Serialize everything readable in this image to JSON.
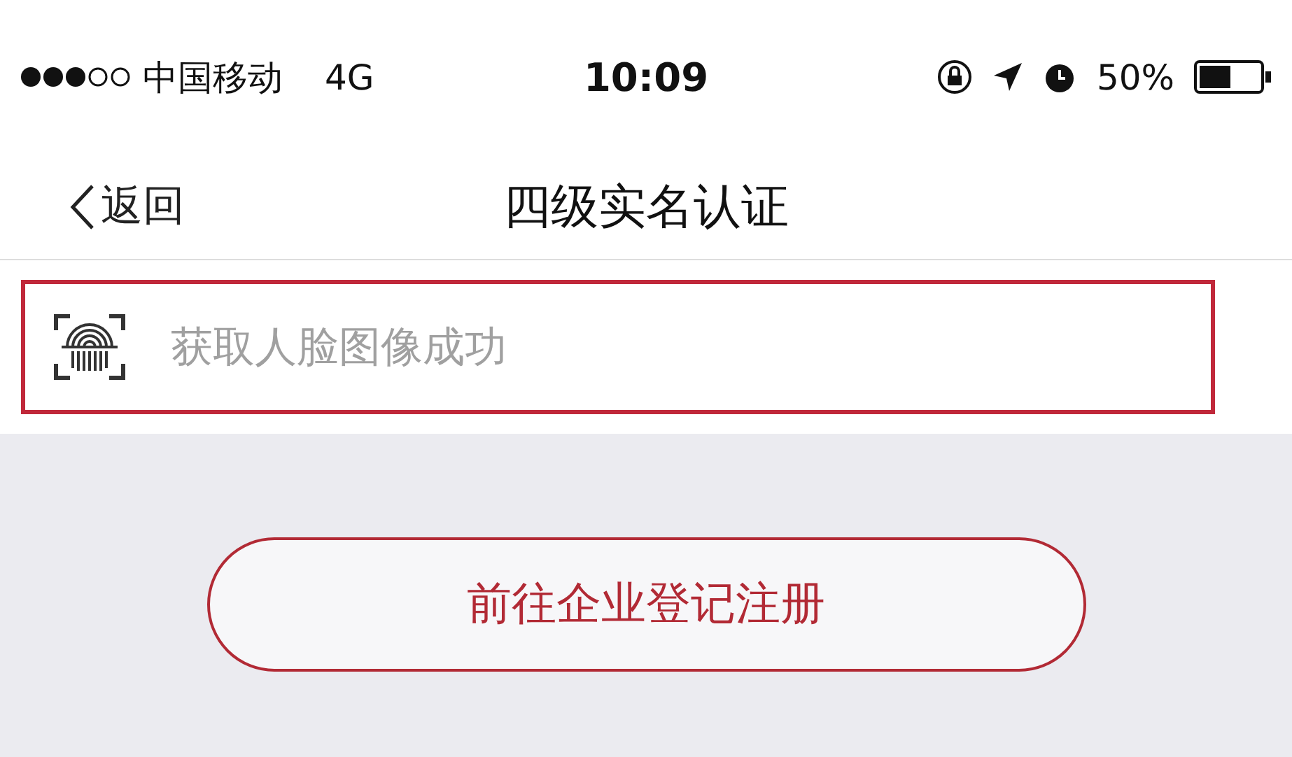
{
  "status_bar": {
    "carrier": "中国移动",
    "network": "4G",
    "time": "10:09",
    "battery": "50%"
  },
  "nav_bar": {
    "back": "返回",
    "title": "四级实名认证"
  },
  "face_field": {
    "placeholder": "获取人脸图像成功"
  },
  "register_button": {
    "label": "前往企业登记注册"
  }
}
